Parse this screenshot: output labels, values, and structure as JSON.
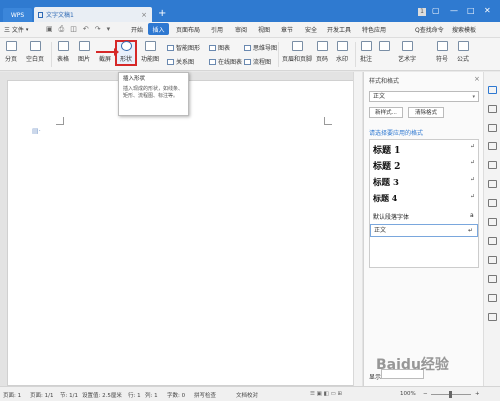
{
  "titlebar": {
    "app_tab": "WPS",
    "doc_tab": "文字文稿1",
    "add_tab": "+",
    "page_count_badge": "1"
  },
  "menubar": {
    "file_label": "三 文件",
    "items": [
      "开始",
      "插入",
      "页面布局",
      "引用",
      "审阅",
      "视图",
      "章节",
      "安全",
      "开发工具",
      "特色应用"
    ],
    "active_index": 1,
    "search_label": "Q查找命令",
    "search_template": "搜索模板"
  },
  "toolbar": {
    "pagination": "分页",
    "blank_page": "空白页",
    "table": "表格",
    "picture": "图片",
    "screenshot": "截屏",
    "shape": "形状",
    "function_chart": "功能图",
    "smart_graphic": "智能图形",
    "relation_chart": "关系图",
    "chart": "图表",
    "online_chart": "在线图表",
    "mindmap": "思维导图",
    "flowchart": "流程图",
    "header_footer": "页眉和页脚",
    "page_number": "页码",
    "watermark": "水印",
    "comment": "批注",
    "art_text": "艺术字",
    "symbol": "符号",
    "formula": "公式"
  },
  "tooltip": {
    "title": "插入形状",
    "body": "插入现成的形状，如线条、矩形、流程图、标注等。"
  },
  "panel": {
    "title": "样式和格式",
    "current_style": "正文",
    "new_style_button": "新样式...",
    "clear_format_button": "清除格式",
    "apply_label": "请选择要应用的格式",
    "styles": [
      {
        "name": "标题 1",
        "mark": "↵"
      },
      {
        "name": "标题 2",
        "mark": "↵"
      },
      {
        "name": "标题 3",
        "mark": "↵"
      },
      {
        "name": "标题 4",
        "mark": "↵"
      }
    ],
    "default_font": "默认段落字体",
    "default_font_mark": "a",
    "body_style": "正文",
    "body_mark": "↵",
    "show_label": "显示:"
  },
  "statusbar": {
    "page": "页面: 1",
    "section_page": "页面: 1/1",
    "section": "节: 1/1",
    "setting": "设置值: 2.5厘米",
    "row": "行: 1",
    "column": "列: 1",
    "word_count": "字数: 0",
    "spell_check": "拼写检查",
    "doc_check": "文档校对",
    "zoom": "100%",
    "zoom_minus": "−",
    "zoom_plus": "+"
  },
  "watermark_text": "Baidu经验",
  "colors": {
    "titlebar": "#2f7ad0",
    "accent": "#2e78d1",
    "highlight": "#d62828"
  }
}
